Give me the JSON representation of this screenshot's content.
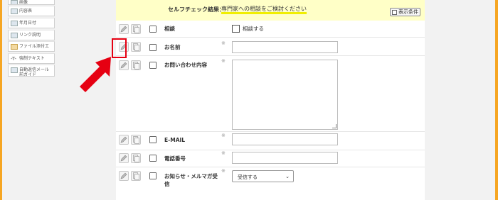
{
  "sidebar": {
    "items": [
      {
        "label": "画像",
        "icon": "image-icon"
      },
      {
        "label": "内容表",
        "icon": "list-icon"
      },
      {
        "label": "年月日付",
        "icon": "calendar-icon"
      },
      {
        "label": "リンク説明",
        "icon": "link-icon"
      },
      {
        "label": "ファイル添付エ",
        "icon": "folder-icon"
      },
      {
        "label": "強制テキスト",
        "icon": "text-icon"
      },
      {
        "label": "自動返信メール前ガイド",
        "icon": "mail-icon"
      }
    ]
  },
  "banner": {
    "label": "セルフチェック結果：",
    "text": "専門家への相談をご検討ください",
    "condition_button": "表示条件"
  },
  "rows": [
    {
      "label": "相談",
      "required_mark": "",
      "field": "checkbox",
      "checkbox_label": "相談する"
    },
    {
      "label": "お名前",
      "required_mark": "※",
      "field": "text",
      "value": ""
    },
    {
      "label": "お問い合わせ内容",
      "required_mark": "※",
      "field": "textarea",
      "value": ""
    },
    {
      "label": "E-MAIL",
      "required_mark": "※",
      "field": "text",
      "value": ""
    },
    {
      "label": "電話番号",
      "required_mark": "※",
      "field": "text",
      "value": ""
    },
    {
      "label": "お知らせ・メルマガ受信",
      "required_mark": "※",
      "field": "select",
      "value": "受信する"
    }
  ],
  "colors": {
    "outer_border": "#f6a623",
    "banner_bg": "#ffffc7",
    "highlight": "#e60012"
  }
}
